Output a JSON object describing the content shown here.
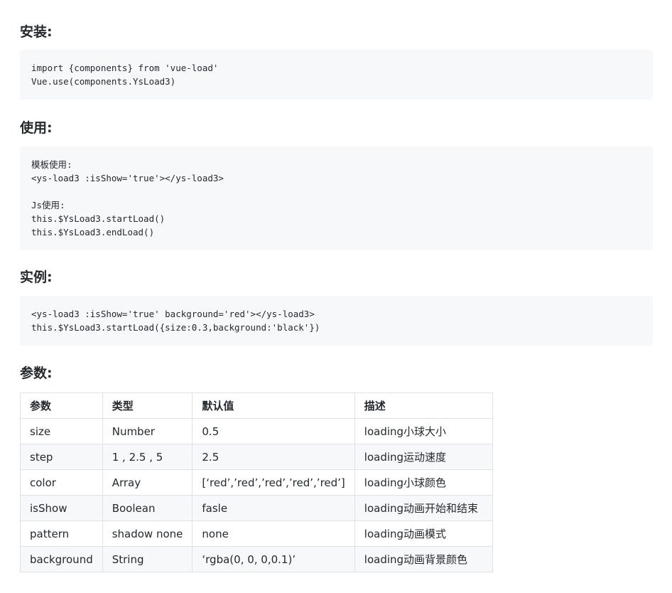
{
  "sections": {
    "install": {
      "title": "安装:",
      "code": [
        "import {components} from 'vue-load'",
        "Vue.use(components.YsLoad3)"
      ]
    },
    "usage": {
      "title": "使用:",
      "code": [
        "模板使用:",
        "<ys-load3 :isShow='true'></ys-load3>",
        "",
        "Js使用:",
        "this.$YsLoad3.startLoad()",
        "this.$YsLoad3.endLoad()"
      ]
    },
    "example": {
      "title": "实例:",
      "code": [
        "<ys-load3 :isShow='true' background='red'></ys-load3>",
        "this.$YsLoad3.startLoad({size:0.3,background:'black'})"
      ]
    },
    "params": {
      "title": "参数:",
      "headers": [
        "参数",
        "类型",
        "默认值",
        "描述"
      ],
      "rows": [
        [
          "size",
          "Number",
          "0.5",
          "loading小球大小"
        ],
        [
          "step",
          "1 , 2.5 , 5",
          "2.5",
          "loading运动速度"
        ],
        [
          "color",
          "Array",
          "[‘red’,’red’,’red’,’red’,’red’]",
          "loading小球颜色"
        ],
        [
          "isShow",
          "Boolean",
          "fasle",
          "loading动画开始和结束"
        ],
        [
          "pattern",
          "shadow none",
          "none",
          "loading动画模式"
        ],
        [
          "background",
          "String",
          "‘rgba(0, 0, 0,0.1)’",
          "loading动画背景颜色"
        ]
      ]
    }
  }
}
